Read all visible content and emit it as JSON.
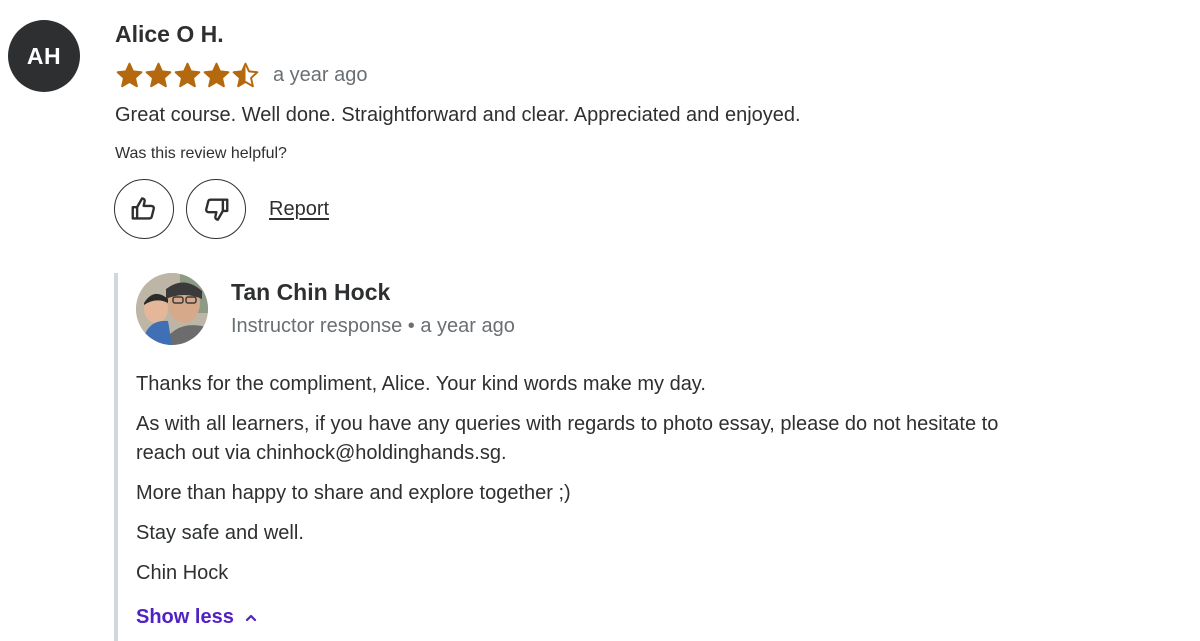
{
  "review": {
    "avatar_initials": "AH",
    "reviewer_name": "Alice O H.",
    "rating": 4.5,
    "rating_max": 5,
    "time": "a year ago",
    "text": "Great course. Well done. Straightforward and clear. Appreciated and enjoyed.",
    "helpful_question": "Was this review helpful?",
    "report_label": "Report",
    "star_color": "#b4690e"
  },
  "response": {
    "instructor_name": "Tan Chin Hock",
    "role": "Instructor response",
    "separator": "•",
    "time": "a year ago",
    "paragraphs": [
      "Thanks for the compliment, Alice. Your kind words make my day.",
      "As with all learners, if you have any queries with regards to photo essay, please do not hesitate to reach out via chinhock@holdinghands.sg.",
      "More than happy to share and explore together ;)",
      "Stay safe and well.",
      "Chin Hock"
    ],
    "show_less_label": "Show less",
    "link_color": "#5022c3"
  }
}
